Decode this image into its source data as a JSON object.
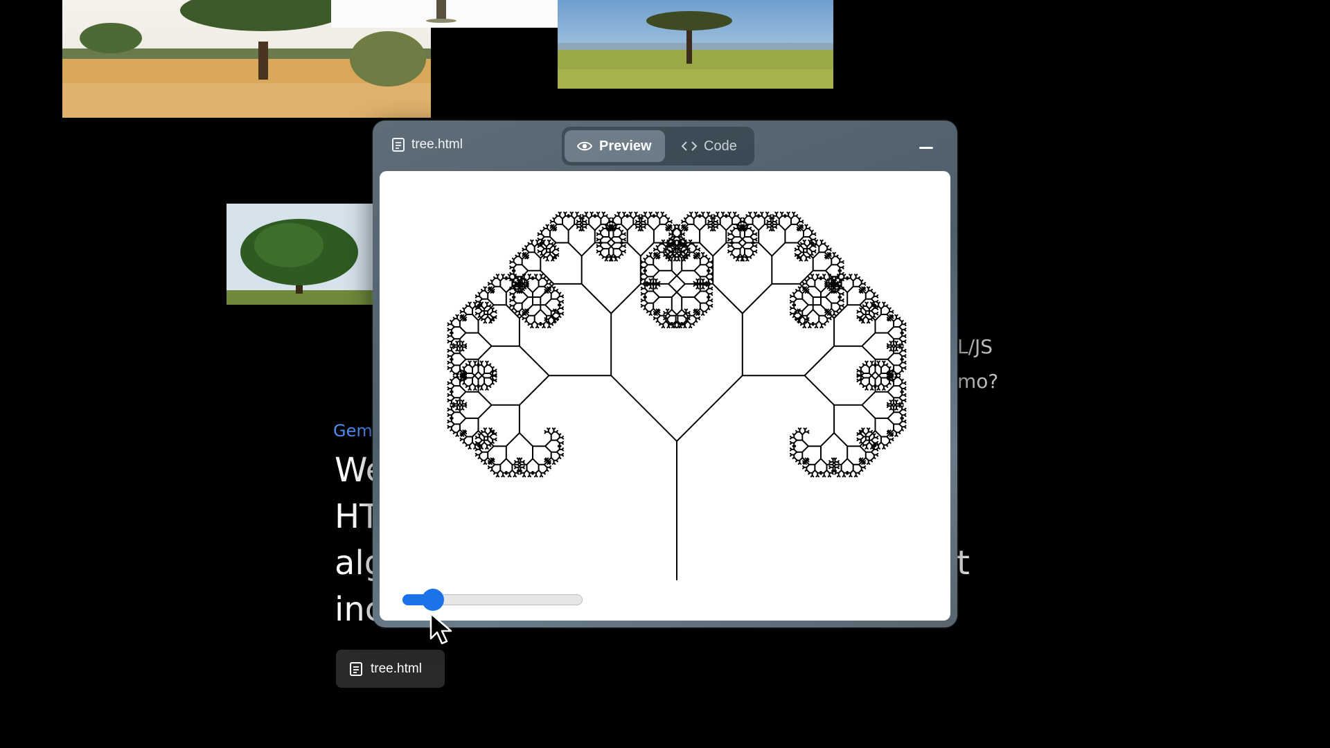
{
  "photos": [
    "acacia-savanna-photo",
    "tree-trunk-photo",
    "acacia-plain-photo",
    "oak-tree-photo"
  ],
  "background_text": {
    "right_line_1": "L/JS",
    "right_line_2": "mo?",
    "gemini_label": "Gemi",
    "prompt_lines": [
      "We",
      "HT",
      "alg",
      "inc"
    ],
    "prompt_tail": "t"
  },
  "attachment": {
    "icon": "document-icon",
    "label": "tree.html"
  },
  "window": {
    "title": "tree.html",
    "tabs": [
      {
        "label": "Preview",
        "icon": "eye-icon",
        "active": true
      },
      {
        "label": "Code",
        "icon": "code-brackets-icon",
        "active": false
      }
    ],
    "minimize_icon": "minimize-icon"
  },
  "preview": {
    "content": "fractal-tree-canvas",
    "slider": {
      "value_fraction": 0.17,
      "color": "#1a73e8"
    }
  },
  "colors": {
    "accent": "#1a73e8",
    "gemini_blue": "#4f8df5"
  }
}
